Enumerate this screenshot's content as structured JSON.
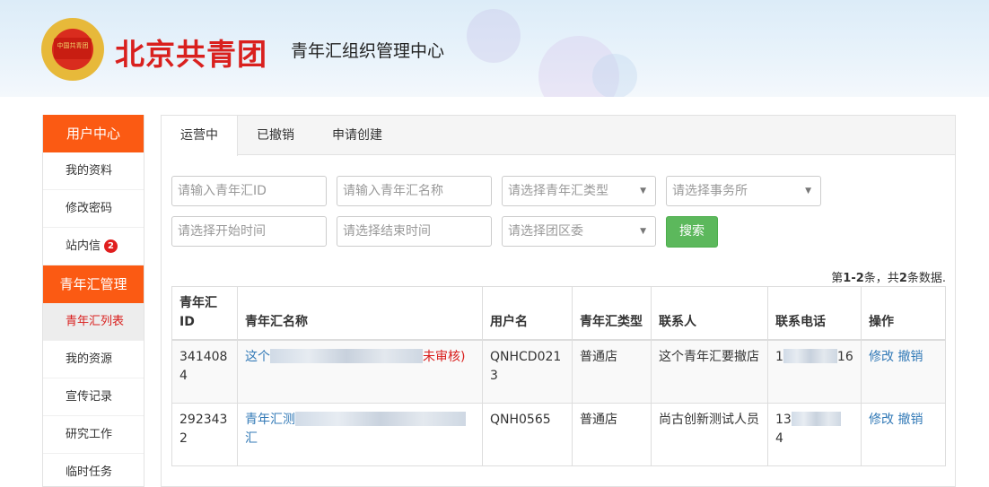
{
  "header": {
    "emblem_text": "中国共青团",
    "brand": "北京共青团",
    "subtitle": "青年汇组织管理中心"
  },
  "sidebar": {
    "section1": "用户中心",
    "items1": [
      "我的资料",
      "修改密码",
      "站内信"
    ],
    "message_badge": "2",
    "section2": "青年汇管理",
    "items2": [
      "青年汇列表",
      "我的资源",
      "宣传记录",
      "研究工作",
      "临时任务"
    ]
  },
  "tabs": [
    "运营中",
    "已撤销",
    "申请创建"
  ],
  "filters": {
    "id_placeholder": "请输入青年汇ID",
    "name_placeholder": "请输入青年汇名称",
    "type_select": "请选择青年汇类型",
    "office_select": "请选择事务所",
    "start_placeholder": "请选择开始时间",
    "end_placeholder": "请选择结束时间",
    "committee_select": "请选择团区委",
    "search_button": "搜索"
  },
  "summary": {
    "prefix": "第",
    "range": "1-2",
    "mid": "条，共",
    "total": "2",
    "suffix": "条数据."
  },
  "table": {
    "headers": [
      "青年汇ID",
      "青年汇名称",
      "用户名",
      "青年汇类型",
      "联系人",
      "联系电话",
      "操作"
    ],
    "rows": [
      {
        "id": "3414084",
        "name_start": "这个",
        "name_end": "未审核)",
        "username": "QNHCD0213",
        "type": "普通店",
        "contact": "这个青年汇要撤店",
        "phone_start": "1",
        "phone_end": "16",
        "edit": "修改",
        "revoke": "撤销"
      },
      {
        "id": "2923432",
        "name_start": "青年汇测",
        "name_end": "汇",
        "username": "QNH0565",
        "type": "普通店",
        "contact": "尚古创新测试人员",
        "phone_start": "13",
        "phone_end": "4",
        "edit": "修改",
        "revoke": "撤销"
      }
    ]
  },
  "colors": {
    "accent": "#fb5a13",
    "brand_red": "#d9201e",
    "search_green": "#5cb85c",
    "link_blue": "#337ab7"
  }
}
